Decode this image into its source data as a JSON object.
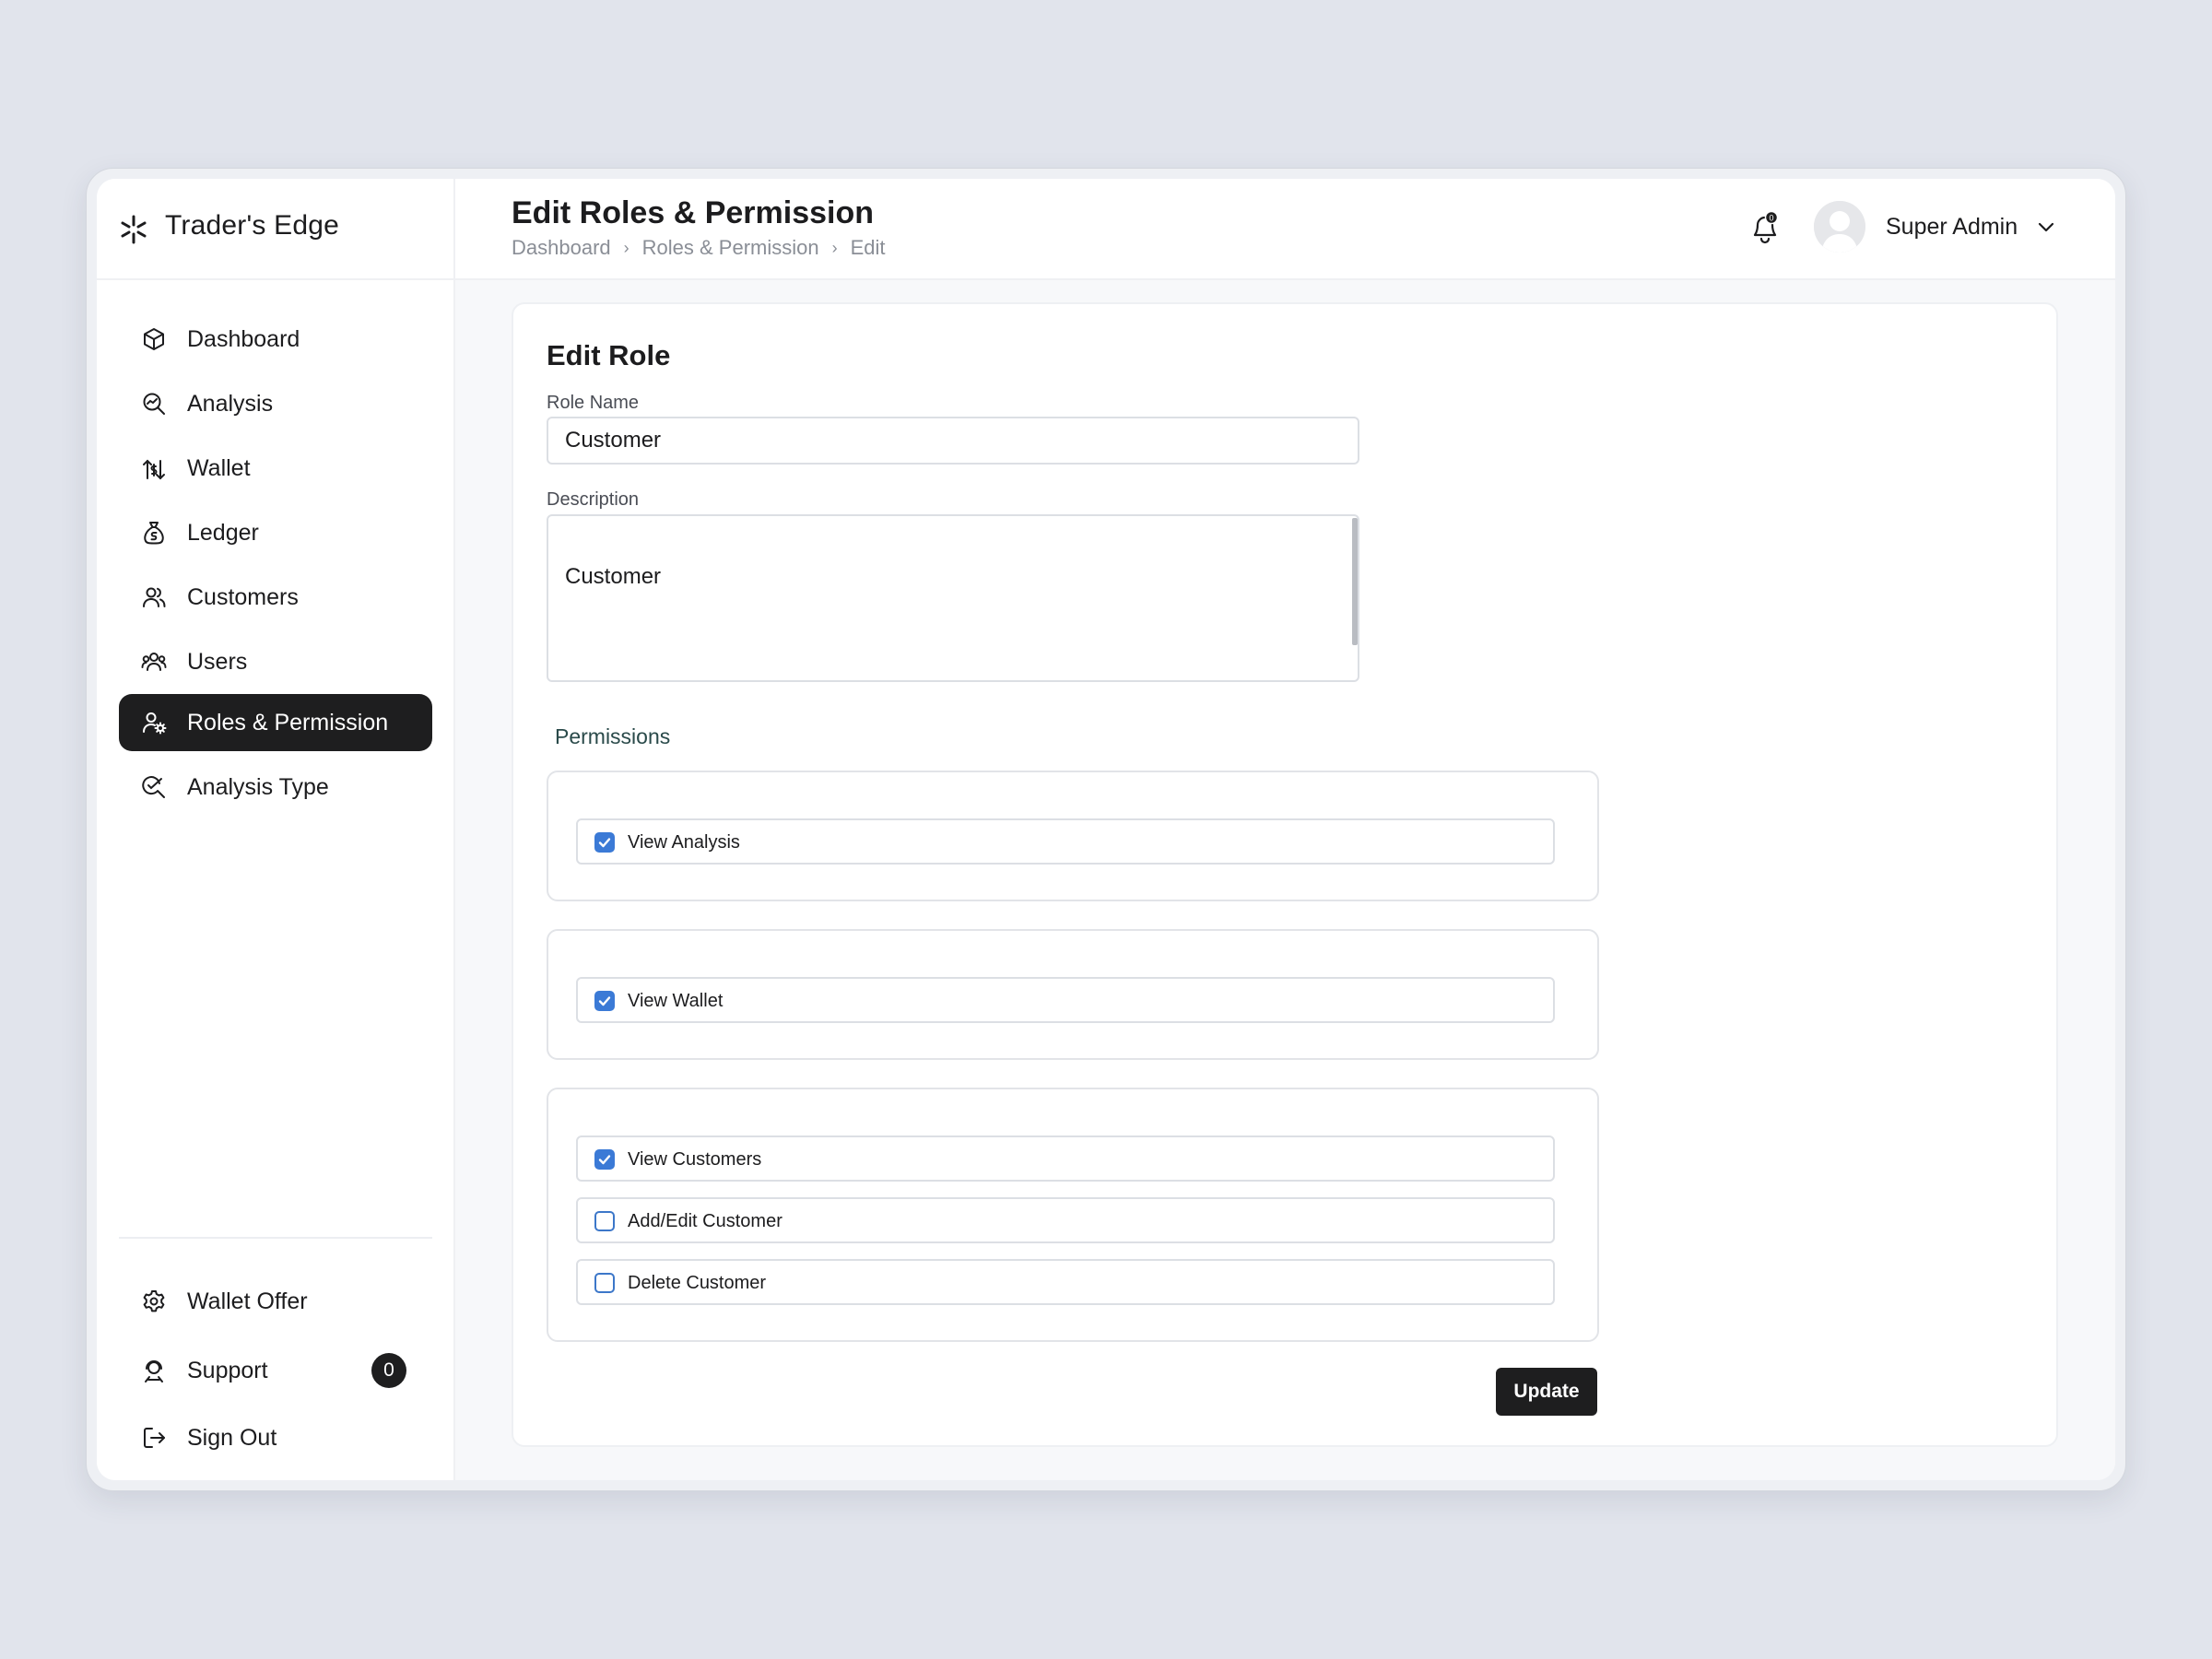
{
  "brand": {
    "name": "Trader's Edge",
    "icon": "sparkle-icon"
  },
  "sidebar": {
    "items": [
      {
        "label": "Dashboard",
        "icon": "cube-icon"
      },
      {
        "label": "Analysis",
        "icon": "magnify-chart-icon"
      },
      {
        "label": "Wallet",
        "icon": "wallet-transfer-icon"
      },
      {
        "label": "Ledger",
        "icon": "money-bag-icon"
      },
      {
        "label": "Customers",
        "icon": "customers-icon"
      },
      {
        "label": "Users",
        "icon": "users-group-icon"
      },
      {
        "label": "Roles & Permission",
        "icon": "user-gear-icon",
        "active": true
      },
      {
        "label": "Analysis Type",
        "icon": "search-check-icon"
      }
    ],
    "bottom_items": [
      {
        "label": "Wallet Offer",
        "icon": "gear-icon"
      },
      {
        "label": "Support",
        "icon": "support-icon",
        "badge": "0"
      },
      {
        "label": "Sign Out",
        "icon": "sign-out-icon"
      }
    ]
  },
  "header": {
    "title": "Edit Roles & Permission",
    "breadcrumb": [
      "Dashboard",
      "Roles & Permission",
      "Edit"
    ],
    "notification_count": "0",
    "user_name": "Super Admin"
  },
  "form": {
    "title": "Edit Role",
    "role_name_label": "Role Name",
    "role_name_value": "Customer",
    "description_label": "Description",
    "description_value": "Customer",
    "permissions_heading": "Permissions",
    "groups": [
      {
        "permissions": [
          {
            "label": "View Analysis",
            "checked": true
          }
        ]
      },
      {
        "permissions": [
          {
            "label": "View Wallet",
            "checked": true
          }
        ]
      },
      {
        "permissions": [
          {
            "label": "View Customers",
            "checked": true
          },
          {
            "label": "Add/Edit Customer",
            "checked": false
          },
          {
            "label": "Delete Customer",
            "checked": false
          }
        ]
      }
    ],
    "update_label": "Update"
  },
  "colors": {
    "accent": "#3b7ad6",
    "dark": "#1e1e1f",
    "background": "#e1e4ec"
  }
}
